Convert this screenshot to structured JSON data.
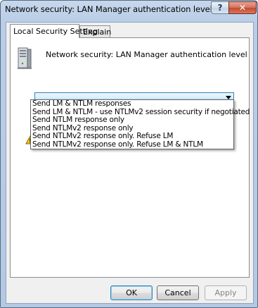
{
  "window": {
    "title": "Network security: LAN Manager authentication level Properties",
    "help_label": "?",
    "close_label": "✕"
  },
  "tabs": [
    {
      "label": "Local Security Setting",
      "active": true
    },
    {
      "label": "Explain",
      "active": false
    }
  ],
  "policy": {
    "name": "Network security: LAN Manager authentication level",
    "icon": "server-icon"
  },
  "combo": {
    "selected": "",
    "options": [
      "Send LM & NTLM responses",
      "Send LM & NTLM - use NTLMv2 session security if negotiated",
      "Send NTLM response only",
      "Send NTLMv2 response only",
      "Send NTLMv2 response only. Refuse LM",
      "Send NTLMv2 response only. Refuse LM & NTLM"
    ]
  },
  "buttons": {
    "ok": "OK",
    "cancel": "Cancel",
    "apply": "Apply"
  },
  "colors": {
    "title_bar": "#b9cde6",
    "close_button": "#c24a31",
    "combo_highlight": "#bee6fd"
  }
}
